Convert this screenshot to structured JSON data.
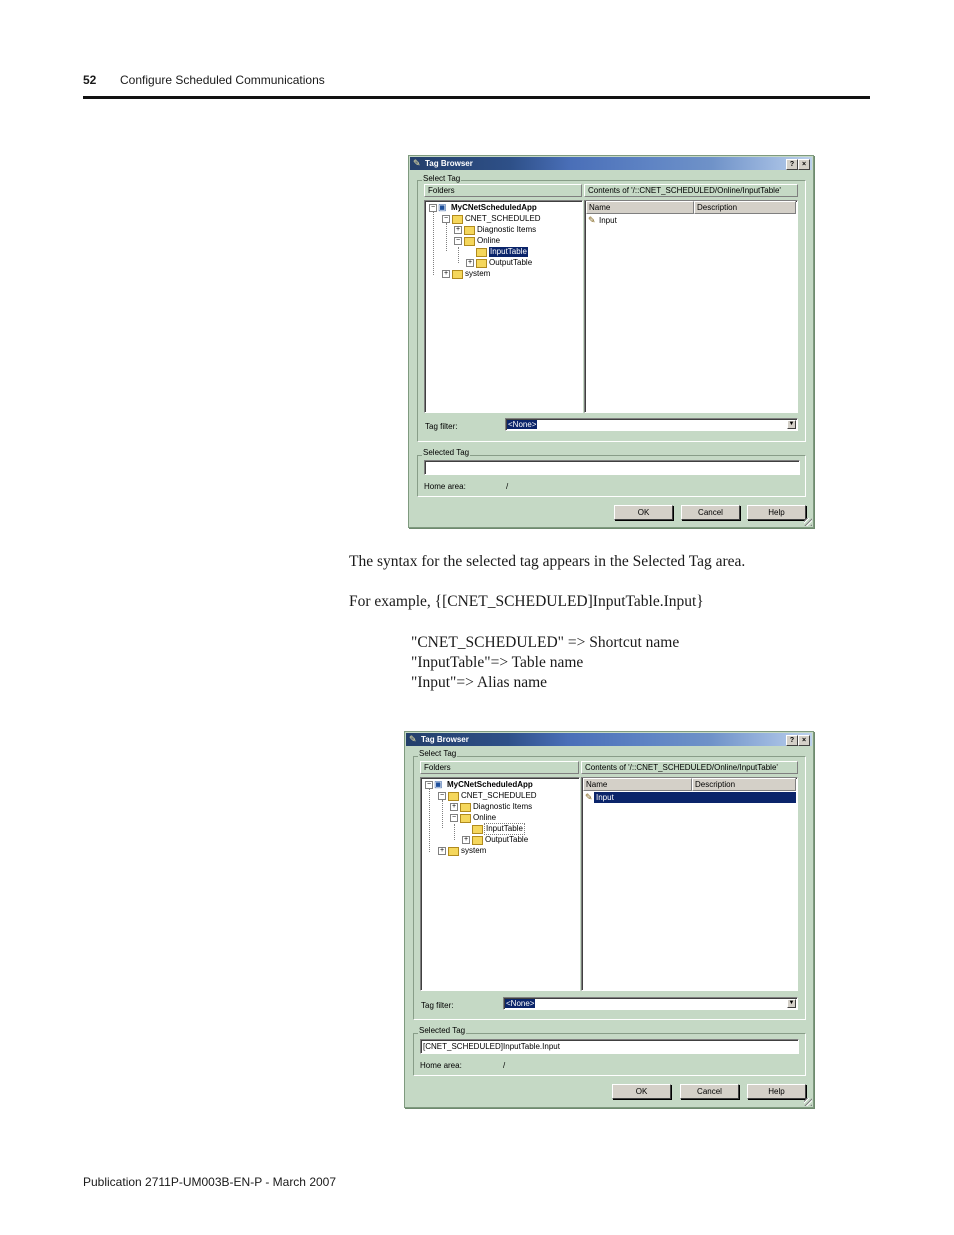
{
  "header": {
    "page_number": "52",
    "chapter_title": "Configure Scheduled Communications"
  },
  "footer": {
    "publication": "Publication 2711P-UM003B-EN-P - March 2007"
  },
  "body": {
    "paragraph1": "The syntax for the selected tag appears in the Selected Tag area.",
    "paragraph2": "For example, {[CNET_SCHEDULED]InputTable.Input}",
    "mapping_lines": [
      "\"CNET_SCHEDULED\" => Shortcut name",
      "\"InputTable\"=> Table name",
      "\"Input\"=> Alias name"
    ]
  },
  "dialog": {
    "title": "Tag Browser",
    "help_button": "?",
    "close_button": "×",
    "select_tag_group": "Select Tag",
    "folders_label": "Folders",
    "contents_label": "Contents of '/::CNET_SCHEDULED/Online/InputTable'",
    "list_columns": [
      "Name",
      "Description"
    ],
    "tree": {
      "root": "MyCNetScheduledApp",
      "cnet": "CNET_SCHEDULED",
      "diagnostic": "Diagnostic Items",
      "online": "Online",
      "input_table": "InputTable",
      "output_table": "OutputTable",
      "system": "system",
      "expand_symbol": "+",
      "collapse_symbol": "−"
    },
    "list_item": "Input",
    "tag_filter_label": "Tag filter:",
    "tag_filter_value": "<None>",
    "dropdown_arrow": "▼",
    "selected_tag_group": "Selected Tag",
    "home_area_label": "Home area:",
    "home_area_value": "/",
    "buttons": {
      "ok": "OK",
      "cancel": "Cancel",
      "help": "Help"
    }
  },
  "dialog_before": {
    "selected_tag_value": ""
  },
  "dialog_after": {
    "selected_tag_value": "[CNET_SCHEDULED]InputTable.Input"
  },
  "colors": {
    "dialog_bg": "#c5d9c5",
    "selection": "#0a246a",
    "title_bar": "#2e5088"
  },
  "icons": {
    "title": "tag-icon",
    "root": "application-icon",
    "folder": "folder-icon",
    "list_item": "tag-icon"
  }
}
